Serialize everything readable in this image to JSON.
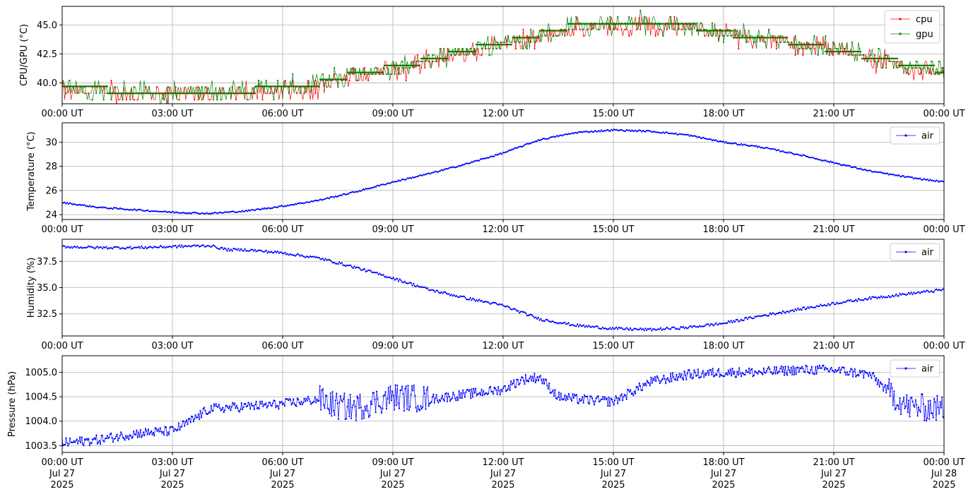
{
  "chart_data": [
    {
      "type": "line",
      "ylabel": "CPU/GPU (°C)",
      "ylim": [
        38.2,
        46.6
      ],
      "yticks": [
        40.0,
        42.5,
        45.0
      ],
      "ytick_labels": [
        "40.0",
        "42.5",
        "45.0"
      ],
      "xtick_labels": [
        "00:00 UT",
        "03:00 UT",
        "06:00 UT",
        "09:00 UT",
        "12:00 UT",
        "15:00 UT",
        "18:00 UT",
        "21:00 UT",
        "00:00 UT"
      ],
      "grid": true,
      "legend_position": "upper-right",
      "x_hours": [
        0,
        1,
        2,
        3,
        4,
        5,
        6,
        7,
        7.5,
        8,
        9,
        10,
        10.5,
        11,
        12,
        13,
        13.5,
        14,
        15,
        16,
        17,
        17.5,
        18,
        19,
        20,
        21,
        22,
        23,
        24
      ],
      "series": [
        {
          "name": "cpu",
          "color": "#ff0000",
          "marker": true,
          "values": [
            39.2,
            39.2,
            39.0,
            39.0,
            39.0,
            39.1,
            39.3,
            39.6,
            40.2,
            40.4,
            41.0,
            41.8,
            42.2,
            42.5,
            43.3,
            44.0,
            44.3,
            44.6,
            44.9,
            45.0,
            44.8,
            44.5,
            44.1,
            43.8,
            43.3,
            42.7,
            42.0,
            41.2,
            40.8
          ]
        },
        {
          "name": "gpu",
          "color": "#008000",
          "marker": true,
          "values": [
            39.4,
            39.4,
            39.1,
            39.1,
            39.1,
            39.2,
            39.5,
            39.8,
            40.4,
            40.6,
            41.2,
            41.9,
            42.4,
            42.7,
            43.4,
            44.1,
            44.4,
            44.8,
            45.0,
            45.1,
            44.9,
            44.6,
            44.2,
            43.9,
            43.4,
            42.8,
            42.2,
            41.4,
            41.0
          ]
        }
      ],
      "steps": [
        39.7,
        38.8,
        40.7,
        41.9,
        42.8,
        43.4,
        44.0,
        44.6,
        45.2,
        43.9,
        43.4,
        42.8,
        41.9,
        41.2
      ]
    },
    {
      "type": "line",
      "ylabel": "Temperature (°C)",
      "ylim": [
        23.6,
        31.6
      ],
      "yticks": [
        24,
        26,
        28,
        30
      ],
      "ytick_labels": [
        "24",
        "26",
        "28",
        "30"
      ],
      "xtick_labels": [
        "00:00 UT",
        "03:00 UT",
        "06:00 UT",
        "09:00 UT",
        "12:00 UT",
        "15:00 UT",
        "18:00 UT",
        "21:00 UT",
        "00:00 UT"
      ],
      "grid": true,
      "legend_position": "upper-right",
      "x_hours": [
        0,
        1,
        2,
        3,
        4,
        5,
        6,
        7,
        8,
        9,
        10,
        11,
        12,
        13,
        14,
        15,
        16,
        17,
        18,
        19,
        20,
        21,
        22,
        23,
        24
      ],
      "series": [
        {
          "name": "air",
          "color": "#0000ff",
          "marker": true,
          "values": [
            25.0,
            24.6,
            24.4,
            24.2,
            24.1,
            24.3,
            24.7,
            25.2,
            25.9,
            26.7,
            27.4,
            28.2,
            29.1,
            30.2,
            30.8,
            31.0,
            30.9,
            30.6,
            30.0,
            29.6,
            29.0,
            28.3,
            27.6,
            27.1,
            26.7
          ]
        }
      ]
    },
    {
      "type": "line",
      "ylabel": "Humidity (%)",
      "ylim": [
        30.4,
        39.6
      ],
      "yticks": [
        32.5,
        35.0,
        37.5
      ],
      "ytick_labels": [
        "32.5",
        "35.0",
        "37.5"
      ],
      "xtick_labels": [
        "00:00 UT",
        "03:00 UT",
        "06:00 UT",
        "09:00 UT",
        "12:00 UT",
        "15:00 UT",
        "18:00 UT",
        "21:00 UT",
        "00:00 UT"
      ],
      "grid": true,
      "legend_position": "upper-right",
      "x_hours": [
        0,
        1,
        2,
        3,
        4,
        4.5,
        5,
        6,
        7,
        8,
        9,
        10,
        11,
        12,
        13,
        14,
        15,
        16,
        17,
        18,
        19,
        20,
        21,
        22,
        23,
        24
      ],
      "series": [
        {
          "name": "air",
          "color": "#0000ff",
          "marker": true,
          "values": [
            38.9,
            38.8,
            38.8,
            38.9,
            39.0,
            38.6,
            38.6,
            38.3,
            37.8,
            36.9,
            35.9,
            34.8,
            34.0,
            33.3,
            32.0,
            31.4,
            31.1,
            31.0,
            31.2,
            31.6,
            32.3,
            32.9,
            33.5,
            34.0,
            34.4,
            34.8
          ]
        }
      ]
    },
    {
      "type": "line",
      "ylabel": "Pressure (hPa)",
      "ylim": [
        1003.36,
        1005.34
      ],
      "yticks": [
        1003.5,
        1004.0,
        1004.5,
        1005.0
      ],
      "ytick_labels": [
        "1003.5",
        "1004.0",
        "1004.5",
        "1005.0"
      ],
      "xtick_labels": [
        [
          "00:00 UT",
          "Jul 27",
          "2025"
        ],
        [
          "03:00 UT",
          "Jul 27",
          "2025"
        ],
        [
          "06:00 UT",
          "Jul 27",
          "2025"
        ],
        [
          "09:00 UT",
          "Jul 27",
          "2025"
        ],
        [
          "12:00 UT",
          "Jul 27",
          "2025"
        ],
        [
          "15:00 UT",
          "Jul 27",
          "2025"
        ],
        [
          "18:00 UT",
          "Jul 27",
          "2025"
        ],
        [
          "21:00 UT",
          "Jul 27",
          "2025"
        ],
        [
          "00:00 UT",
          "Jul 28",
          "2025"
        ]
      ],
      "grid": true,
      "legend_position": "upper-right",
      "x_hours": [
        0,
        1,
        2,
        3,
        3.5,
        4,
        5,
        6,
        7,
        7.5,
        8,
        9,
        10,
        11,
        12,
        12.5,
        13,
        13.5,
        14,
        15,
        16,
        17,
        18,
        19,
        20,
        21,
        22,
        22.5,
        23,
        24
      ],
      "series": [
        {
          "name": "air",
          "color": "#0000ff",
          "marker": true,
          "values": [
            1003.55,
            1003.62,
            1003.75,
            1003.8,
            1004.0,
            1004.25,
            1004.3,
            1004.35,
            1004.45,
            1004.3,
            1004.28,
            1004.5,
            1004.45,
            1004.55,
            1004.65,
            1004.85,
            1004.9,
            1004.5,
            1004.45,
            1004.4,
            1004.8,
            1004.95,
            1005.0,
            1005.0,
            1005.05,
            1005.05,
            1004.95,
            1004.6,
            1004.3,
            1004.25
          ]
        }
      ]
    }
  ]
}
